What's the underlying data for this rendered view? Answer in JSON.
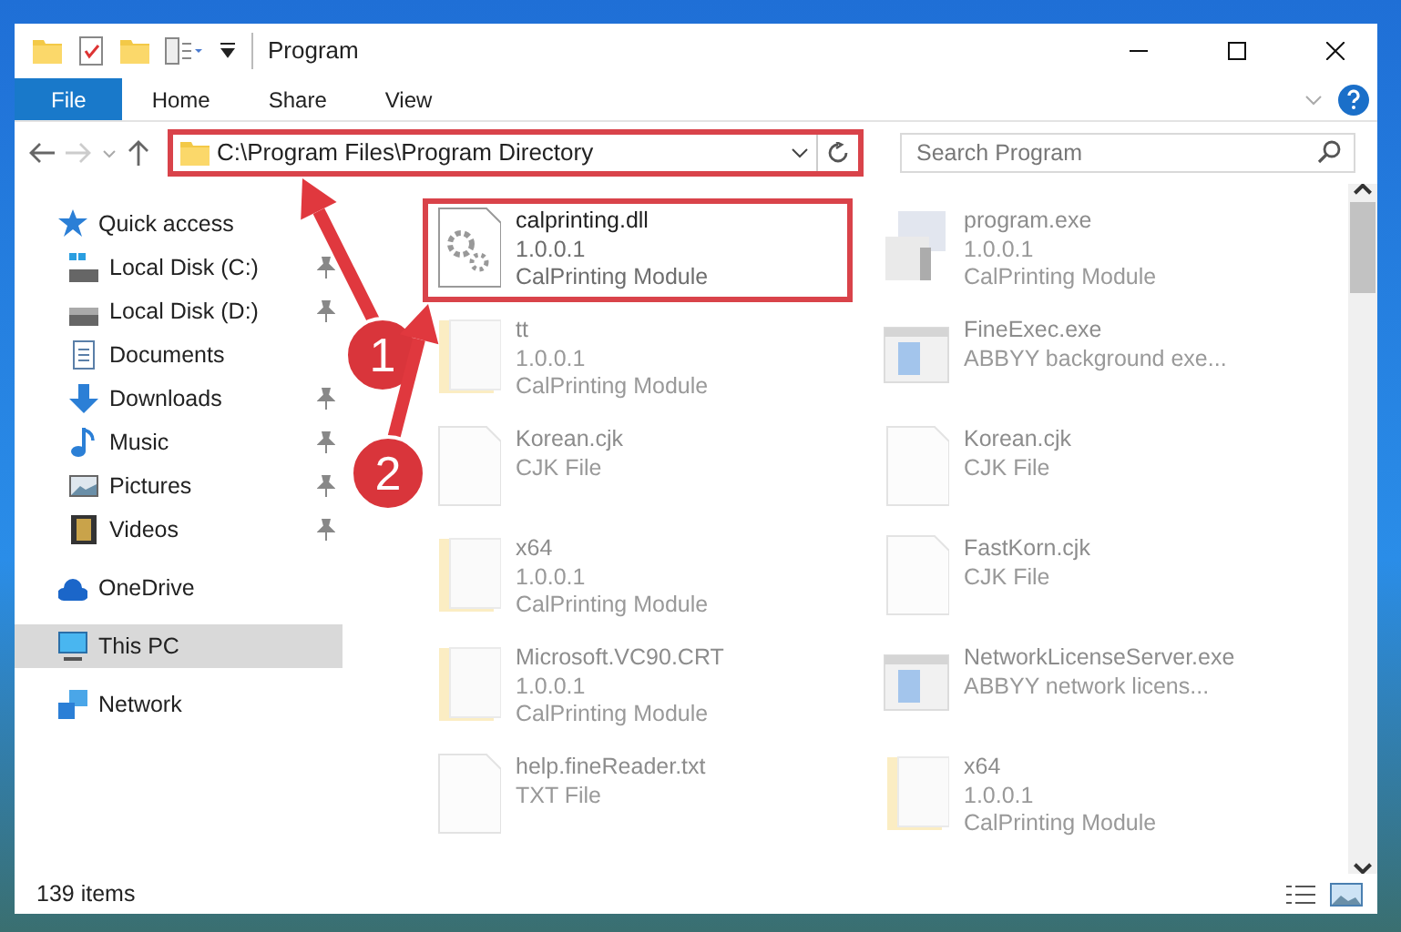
{
  "window": {
    "title": "Program"
  },
  "ribbon_tabs": [
    {
      "label": "File",
      "selected": true
    },
    {
      "label": "Home",
      "selected": false
    },
    {
      "label": "Share",
      "selected": false
    },
    {
      "label": "View",
      "selected": false
    }
  ],
  "address": {
    "path": "C:\\Program Files\\Program Directory",
    "highlighted": true
  },
  "search": {
    "placeholder": "Search Program"
  },
  "sidebar": {
    "items": [
      {
        "label": "Quick access",
        "kind": "star",
        "selected": false,
        "children": [
          {
            "label": "Local Disk (C:)",
            "kind": "system",
            "pinned": true,
            "selected": false
          },
          {
            "label": "Local Disk (D:)",
            "kind": "drive",
            "pinned": true,
            "selected": false
          },
          {
            "label": "Documents",
            "kind": "document",
            "pinned": false,
            "selected": false
          },
          {
            "label": "Downloads",
            "kind": "download",
            "pinned": true,
            "selected": false
          },
          {
            "label": "Music",
            "kind": "music",
            "pinned": true,
            "selected": false
          },
          {
            "label": "Pictures",
            "kind": "pictures",
            "pinned": true,
            "selected": false
          },
          {
            "label": "Videos",
            "kind": "videos",
            "pinned": true,
            "selected": false
          }
        ]
      },
      {
        "label": "OneDrive",
        "kind": "cloud",
        "selected": false
      },
      {
        "label": "This PC",
        "kind": "computer",
        "selected": true
      },
      {
        "label": "Network",
        "kind": "network",
        "selected": false
      }
    ]
  },
  "files": [
    {
      "name": "calprinting.dll",
      "lines": [
        "1.0.0.1",
        "CalPrinting Module"
      ],
      "kind": "dll",
      "faded": false,
      "highlighted": true
    },
    {
      "name": "program.exe",
      "lines": [
        "1.0.0.1",
        "CalPrinting Module"
      ],
      "kind": "setup",
      "faded": true,
      "highlighted": false
    },
    {
      "name": "tt",
      "lines": [
        "1.0.0.1",
        "CalPrinting Module"
      ],
      "kind": "folder",
      "faded": true,
      "highlighted": false
    },
    {
      "name": "FineExec.exe",
      "lines": [
        "ABBYY background exe..."
      ],
      "kind": "app",
      "faded": true,
      "highlighted": false
    },
    {
      "name": "Korean.cjk",
      "lines": [
        "CJK File"
      ],
      "kind": "blank",
      "faded": true,
      "highlighted": false
    },
    {
      "name": "Korean.cjk",
      "lines": [
        "CJK File"
      ],
      "kind": "blank",
      "faded": true,
      "highlighted": false
    },
    {
      "name": "x64",
      "lines": [
        "1.0.0.1",
        "CalPrinting Module"
      ],
      "kind": "folder",
      "faded": true,
      "highlighted": false
    },
    {
      "name": "FastKorn.cjk",
      "lines": [
        "CJK File"
      ],
      "kind": "blank",
      "faded": true,
      "highlighted": false
    },
    {
      "name": "Microsoft.VC90.CRT",
      "lines": [
        "1.0.0.1",
        "CalPrinting Module"
      ],
      "kind": "folder",
      "faded": true,
      "highlighted": false
    },
    {
      "name": "NetworkLicenseServer.exe",
      "lines": [
        "ABBYY network licens..."
      ],
      "kind": "app",
      "faded": true,
      "highlighted": false
    },
    {
      "name": "help.fineReader.txt",
      "lines": [
        "TXT File"
      ],
      "kind": "blank",
      "faded": true,
      "highlighted": false
    },
    {
      "name": "x64",
      "lines": [
        "1.0.0.1",
        "CalPrinting Module"
      ],
      "kind": "folder",
      "faded": true,
      "highlighted": false
    }
  ],
  "annotations": [
    {
      "label": "1"
    },
    {
      "label": "2"
    }
  ],
  "status_bar": {
    "count": "139 items"
  }
}
